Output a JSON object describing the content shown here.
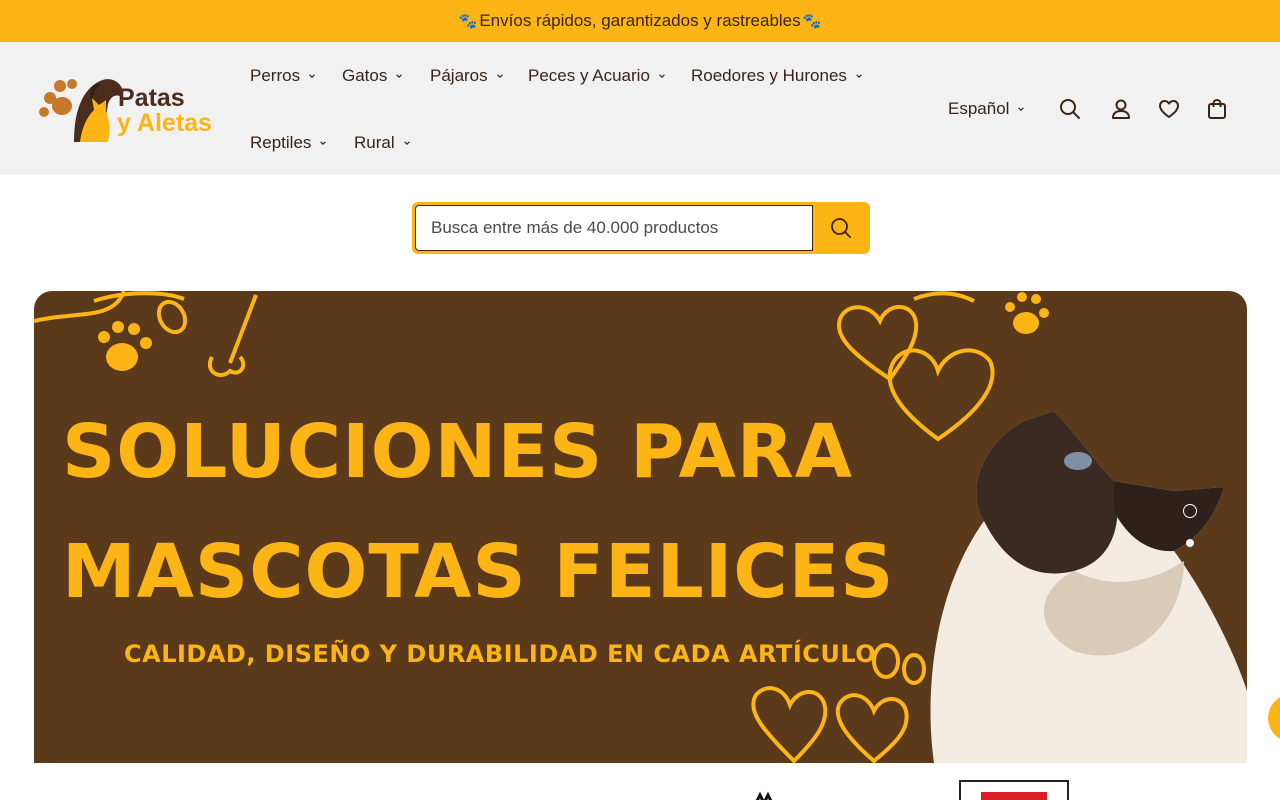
{
  "announcement": {
    "text": "Envíos rápidos, garantizados y rastreables",
    "paw_icon": "paw-icon"
  },
  "logo": {
    "line1": "Patas",
    "line2": "y Aletas"
  },
  "nav": {
    "items": [
      {
        "label": "Perros"
      },
      {
        "label": "Gatos"
      },
      {
        "label": "Pájaros"
      },
      {
        "label": "Peces y Acuario"
      },
      {
        "label": "Roedores y Hurones"
      },
      {
        "label": "Reptiles"
      },
      {
        "label": "Rural"
      }
    ]
  },
  "utilities": {
    "language": "Español",
    "icons": [
      "search-icon",
      "account-icon",
      "wishlist-heart-icon",
      "cart-bag-icon"
    ]
  },
  "search": {
    "placeholder": "Busca entre más de 40.000 productos",
    "button_icon": "search-icon"
  },
  "banner": {
    "headline_line1": "SOLUCIONES PARA",
    "headline_line2": "MASCOTAS FELICES",
    "subheadline": "CALIDAD, DISEÑO Y DURABILIDAD EN CADA ARTÍCULO",
    "slide_count": 2,
    "active_slide": 2
  },
  "colors": {
    "brand_yellow": "#fdb515",
    "brand_brown": "#5b3a1c",
    "text_dark": "#3b2416",
    "header_bg": "#f1f1f1"
  }
}
